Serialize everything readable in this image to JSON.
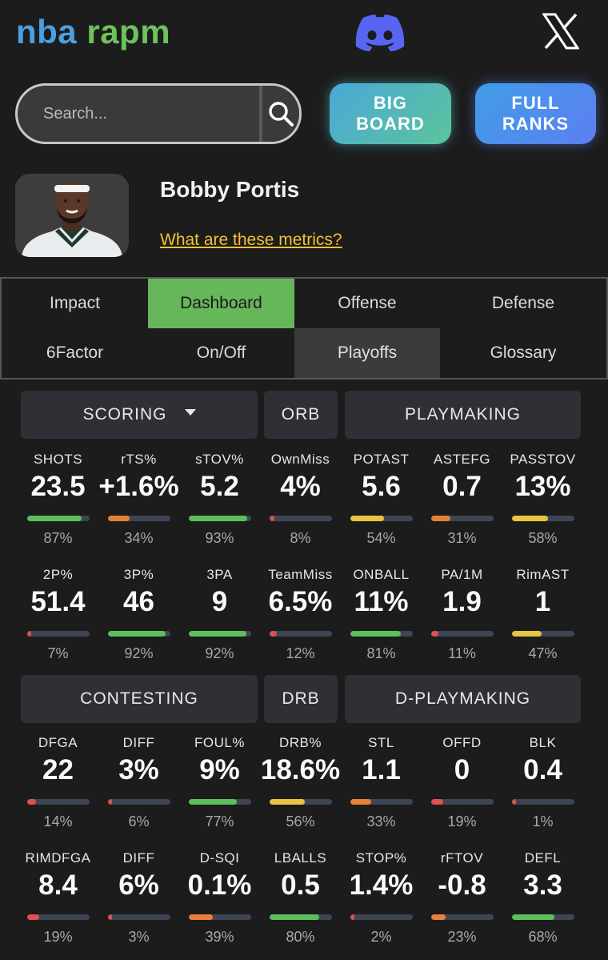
{
  "header": {
    "logo_part1": "nba",
    "logo_part2": "rapm"
  },
  "search": {
    "placeholder": "Search..."
  },
  "buttons": {
    "big_board_line1": "BIG",
    "big_board_line2": "BOARD",
    "full_ranks_line1": "FULL",
    "full_ranks_line2": "RANKS"
  },
  "player": {
    "name": "Bobby Portis",
    "metrics_link": "What are these metrics?"
  },
  "tabs": [
    "Impact",
    "Dashboard",
    "Offense",
    "Defense",
    "6Factor",
    "On/Off",
    "Playoffs",
    "Glossary"
  ],
  "sections": {
    "scoring": "SCORING",
    "orb": "ORB",
    "playmaking": "PLAYMAKING",
    "contesting": "CONTESTING",
    "drb": "DRB",
    "d_playmaking": "D-PLAYMAKING"
  },
  "stats": [
    {
      "label": "SHOTS",
      "value": "23.5",
      "pct": "87%",
      "pct_value": 87,
      "color": "#5cbf5c"
    },
    {
      "label": "rTS%",
      "value": "+1.6%",
      "pct": "34%",
      "pct_value": 34,
      "color": "#e8803a"
    },
    {
      "label": "sTOV%",
      "value": "5.2",
      "pct": "93%",
      "pct_value": 93,
      "color": "#5cbf5c"
    },
    {
      "label": "OwnMiss",
      "value": "4%",
      "pct": "8%",
      "pct_value": 8,
      "color": "#e05050"
    },
    {
      "label": "POTAST",
      "value": "5.6",
      "pct": "54%",
      "pct_value": 54,
      "color": "#e8c440"
    },
    {
      "label": "ASTEFG",
      "value": "0.7",
      "pct": "31%",
      "pct_value": 31,
      "color": "#e8803a"
    },
    {
      "label": "PASSTOV",
      "value": "13%",
      "pct": "58%",
      "pct_value": 58,
      "color": "#e8c440"
    },
    {
      "label": "2P%",
      "value": "51.4",
      "pct": "7%",
      "pct_value": 7,
      "color": "#e05050"
    },
    {
      "label": "3P%",
      "value": "46",
      "pct": "92%",
      "pct_value": 92,
      "color": "#5cbf5c"
    },
    {
      "label": "3PA",
      "value": "9",
      "pct": "92%",
      "pct_value": 92,
      "color": "#5cbf5c"
    },
    {
      "label": "TeamMiss",
      "value": "6.5%",
      "pct": "12%",
      "pct_value": 12,
      "color": "#e05050"
    },
    {
      "label": "ONBALL",
      "value": "11%",
      "pct": "81%",
      "pct_value": 81,
      "color": "#5cbf5c"
    },
    {
      "label": "PA/1M",
      "value": "1.9",
      "pct": "11%",
      "pct_value": 11,
      "color": "#e05050"
    },
    {
      "label": "RimAST",
      "value": "1",
      "pct": "47%",
      "pct_value": 47,
      "color": "#e8c440"
    },
    {
      "label": "DFGA",
      "value": "22",
      "pct": "14%",
      "pct_value": 14,
      "color": "#e05050"
    },
    {
      "label": "DIFF",
      "value": "3%",
      "pct": "6%",
      "pct_value": 6,
      "color": "#e05050"
    },
    {
      "label": "FOUL%",
      "value": "9%",
      "pct": "77%",
      "pct_value": 77,
      "color": "#5cbf5c"
    },
    {
      "label": "DRB%",
      "value": "18.6%",
      "pct": "56%",
      "pct_value": 56,
      "color": "#e8c440"
    },
    {
      "label": "STL",
      "value": "1.1",
      "pct": "33%",
      "pct_value": 33,
      "color": "#e8803a"
    },
    {
      "label": "OFFD",
      "value": "0",
      "pct": "19%",
      "pct_value": 19,
      "color": "#e05050"
    },
    {
      "label": "BLK",
      "value": "0.4",
      "pct": "1%",
      "pct_value": 1,
      "color": "#e05050"
    },
    {
      "label": "RIMDFGA",
      "value": "8.4",
      "pct": "19%",
      "pct_value": 19,
      "color": "#e05050"
    },
    {
      "label": "DIFF",
      "value": "6%",
      "pct": "3%",
      "pct_value": 3,
      "color": "#e05050"
    },
    {
      "label": "D-SQI",
      "value": "0.1%",
      "pct": "39%",
      "pct_value": 39,
      "color": "#e8803a"
    },
    {
      "label": "LBALLS",
      "value": "0.5",
      "pct": "80%",
      "pct_value": 80,
      "color": "#5cbf5c"
    },
    {
      "label": "STOP%",
      "value": "1.4%",
      "pct": "2%",
      "pct_value": 2,
      "color": "#e05050"
    },
    {
      "label": "rFTOV",
      "value": "-0.8",
      "pct": "23%",
      "pct_value": 23,
      "color": "#e8803a"
    },
    {
      "label": "DEFL",
      "value": "3.3",
      "pct": "68%",
      "pct_value": 68,
      "color": "#5cbf5c"
    }
  ]
}
